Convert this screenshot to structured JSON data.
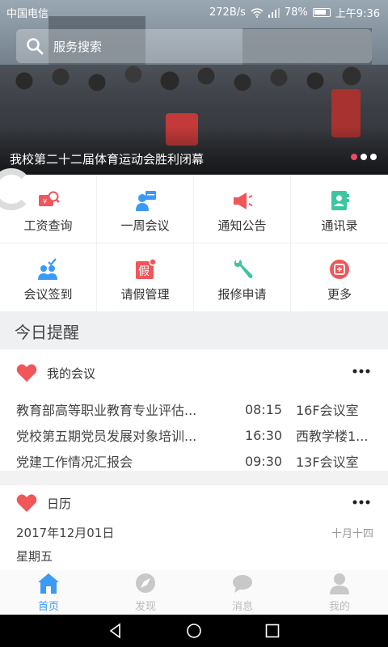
{
  "status_bar": {
    "carrier": "中国电信",
    "speed": "272B/s",
    "battery": "78%",
    "time": "上午9:36"
  },
  "search": {
    "placeholder": "服务搜索"
  },
  "banner": {
    "caption": "我校第二十二届体育运动会胜利闭幕",
    "slides": 3,
    "active_slide": 1
  },
  "menu": {
    "items": [
      {
        "label": "工资查询",
        "icon": "salary-search-icon",
        "color": "#f0565a"
      },
      {
        "label": "一周会议",
        "icon": "weekly-meeting-icon",
        "color": "#3a9af5"
      },
      {
        "label": "通知公告",
        "icon": "announcement-icon",
        "color": "#f0565a"
      },
      {
        "label": "通讯录",
        "icon": "contacts-icon",
        "color": "#3cc6a0"
      },
      {
        "label": "会议签到",
        "icon": "meeting-checkin-icon",
        "color": "#3a9af5"
      },
      {
        "label": "请假管理",
        "icon": "leave-management-icon",
        "color": "#f0565a"
      },
      {
        "label": "报修申请",
        "icon": "repair-wrench-icon",
        "color": "#3cc6a0"
      },
      {
        "label": "更多",
        "icon": "more-icon",
        "color": "#f0565a"
      }
    ]
  },
  "today": {
    "title": "今日提醒"
  },
  "meetings": {
    "title": "我的会议",
    "rows": [
      {
        "name": "教育部高等职业教育专业评估...",
        "time": "08:15",
        "place": "16F会议室"
      },
      {
        "name": "党校第五期党员发展对象培训...",
        "time": "16:30",
        "place": "西教学楼1..."
      },
      {
        "name": "党建工作情况汇报会",
        "time": "09:30",
        "place": "13F会议室"
      }
    ]
  },
  "calendar": {
    "title": "日历",
    "date": "2017年12月01日",
    "lunar": "十月十四",
    "weekday": "星期五"
  },
  "tabs": [
    {
      "label": "首页",
      "active": true
    },
    {
      "label": "发现",
      "active": false
    },
    {
      "label": "消息",
      "active": false
    },
    {
      "label": "我的",
      "active": false
    }
  ],
  "colors": {
    "accent": "#3a9af5",
    "red": "#f0565a",
    "green": "#3cc6a0"
  }
}
